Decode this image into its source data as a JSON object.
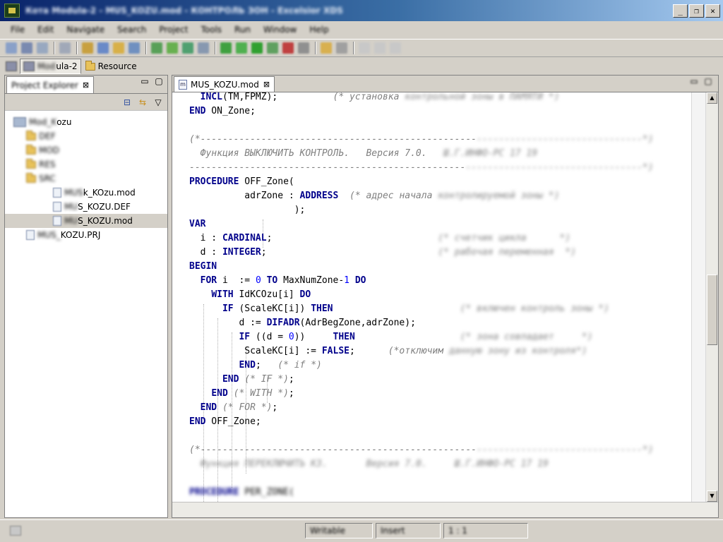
{
  "window": {
    "title": "Кота Modula-2 - MUS_KOZU.mod - КОНТРОЛЬ ЗОН - Excelsior XDS",
    "min_glyph": "_",
    "restore_glyph": "❐",
    "close_glyph": "✕"
  },
  "menu": [
    "File",
    "Edit",
    "Navigate",
    "Search",
    "Project",
    "Tools",
    "Run",
    "Window",
    "Help"
  ],
  "perspectives": {
    "modula_prefix": "Mod",
    "modula_suffix": "ula-2",
    "resource_label": "Resource"
  },
  "explorer": {
    "tab_title": "Project Explorer",
    "close_glyph": "⊠",
    "minimize_glyph": "▭",
    "maximize_glyph": "▢",
    "collapse_glyph": "⊟",
    "link_glyph": "⇆",
    "menu_glyph": "▽",
    "tree": [
      {
        "level": 0,
        "type": "project",
        "blurred": "Mod_K",
        "label": "ozu"
      },
      {
        "level": 1,
        "type": "folder",
        "blurred": "DEF",
        "label": ""
      },
      {
        "level": 1,
        "type": "folder",
        "blurred": "MOD",
        "label": ""
      },
      {
        "level": 1,
        "type": "folder",
        "blurred": "RES",
        "label": ""
      },
      {
        "level": 1,
        "type": "folder",
        "blurred": "SRC",
        "label": ""
      },
      {
        "level": 2,
        "type": "file",
        "blurred": "MUS",
        "label": "k_KOzu.mod"
      },
      {
        "level": 2,
        "type": "file",
        "blurred": "MU",
        "label": "S_KOZU.DEF"
      },
      {
        "level": 2,
        "type": "file",
        "blurred": "MU",
        "label": "S_KOZU.mod",
        "selected": true
      },
      {
        "level": 1,
        "type": "file",
        "blurred": "MUS_",
        "label": "KOZU.PRJ"
      }
    ]
  },
  "editor": {
    "tab_icon_letter": "m",
    "tab_title": "MUS_KOZU.mod",
    "tab_close_glyph": "⊠"
  },
  "code_lines": [
    [
      {
        "t": "  "
      },
      {
        "t": "INCL",
        "c": "kw"
      },
      {
        "t": "(TM,FPMZ);          "
      },
      {
        "t": "(* установка ",
        "c": "cm"
      },
      {
        "t": "контрольной зоны в ПАМЯТИ *)",
        "c": "cm blur"
      }
    ],
    [
      {
        "t": "END",
        "c": "kw"
      },
      {
        "t": " ON_Zone;"
      }
    ],
    [
      {
        "t": ""
      }
    ],
    [
      {
        "t": "(*--------------------------------------------------",
        "c": "cm"
      },
      {
        "t": "------------------------------*)",
        "c": "cm blur"
      }
    ],
    [
      {
        "t": "  Функция ВЫКЛЮЧИТЬ КОНТРОЛЬ.   Версия 7.0.   ",
        "c": "cm"
      },
      {
        "t": "Ш.Г.ИНФО-РС 17 19",
        "c": "cm blur"
      }
    ],
    [
      {
        "t": "--------------------------------------------------",
        "c": "cm"
      },
      {
        "t": "--------------------------------*)",
        "c": "cm blur"
      }
    ],
    [
      {
        "t": "PROCEDURE",
        "c": "kw"
      },
      {
        "t": " OFF_Zone("
      }
    ],
    [
      {
        "t": "          adrZone : "
      },
      {
        "t": "ADDRESS",
        "c": "kw"
      },
      {
        "t": "  "
      },
      {
        "t": "(* адрес начала ",
        "c": "cm"
      },
      {
        "t": "контролируемой зоны *)",
        "c": "cm blur"
      }
    ],
    [
      {
        "t": "                   );"
      }
    ],
    [
      {
        "t": "VAR",
        "c": "kw"
      }
    ],
    [
      {
        "t": "  i : "
      },
      {
        "t": "CARDINAL",
        "c": "kw"
      },
      {
        "t": ";                              "
      },
      {
        "t": "(* счетчик цикла      *)",
        "c": "cm blur"
      }
    ],
    [
      {
        "t": "  d : "
      },
      {
        "t": "INTEGER",
        "c": "kw"
      },
      {
        "t": ";                               "
      },
      {
        "t": "(* рабочая переменная  *)",
        "c": "cm blur"
      }
    ],
    [
      {
        "t": "BEGIN",
        "c": "kw"
      }
    ],
    [
      {
        "t": "  "
      },
      {
        "t": "FOR",
        "c": "kw"
      },
      {
        "t": " i  := "
      },
      {
        "t": "0",
        "c": "num"
      },
      {
        "t": " "
      },
      {
        "t": "TO",
        "c": "kw"
      },
      {
        "t": " MaxNumZone-"
      },
      {
        "t": "1",
        "c": "num"
      },
      {
        "t": " "
      },
      {
        "t": "DO",
        "c": "kw"
      }
    ],
    [
      {
        "t": "    "
      },
      {
        "t": "WITH",
        "c": "kw"
      },
      {
        "t": " IdKCOzu[i] "
      },
      {
        "t": "DO",
        "c": "kw"
      }
    ],
    [
      {
        "t": "      "
      },
      {
        "t": "IF",
        "c": "kw"
      },
      {
        "t": " (ScaleKC[i]) "
      },
      {
        "t": "THEN",
        "c": "kw"
      },
      {
        "t": "                       "
      },
      {
        "t": "(* включен контроль зоны *)",
        "c": "cm blur"
      }
    ],
    [
      {
        "t": "         d := "
      },
      {
        "t": "DIFADR",
        "c": "kw"
      },
      {
        "t": "(AdrBegZone,adrZone);"
      }
    ],
    [
      {
        "t": "         "
      },
      {
        "t": "IF",
        "c": "kw"
      },
      {
        "t": " ((d = "
      },
      {
        "t": "0",
        "c": "num"
      },
      {
        "t": "))     "
      },
      {
        "t": "THEN",
        "c": "kw"
      },
      {
        "t": "                   "
      },
      {
        "t": "(* зона совпадает     *)",
        "c": "cm blur"
      }
    ],
    [
      {
        "t": "          ScaleKC[i] := "
      },
      {
        "t": "FALSE",
        "c": "kw"
      },
      {
        "t": ";      "
      },
      {
        "t": "(*отключим",
        "c": "cm"
      },
      {
        "t": " данную зону из контроля*)",
        "c": "cm blur"
      }
    ],
    [
      {
        "t": "         "
      },
      {
        "t": "END",
        "c": "kw"
      },
      {
        "t": ";   "
      },
      {
        "t": "(* if *)",
        "c": "cm"
      }
    ],
    [
      {
        "t": "      "
      },
      {
        "t": "END",
        "c": "kw"
      },
      {
        "t": " "
      },
      {
        "t": "(* IF *)",
        "c": "cm"
      },
      {
        "t": ";"
      }
    ],
    [
      {
        "t": "    "
      },
      {
        "t": "END",
        "c": "kw"
      },
      {
        "t": " "
      },
      {
        "t": "(* WITH *)",
        "c": "cm"
      },
      {
        "t": ";"
      }
    ],
    [
      {
        "t": "  "
      },
      {
        "t": "END",
        "c": "kw"
      },
      {
        "t": " "
      },
      {
        "t": "(* FOR *)",
        "c": "cm"
      },
      {
        "t": ";"
      }
    ],
    [
      {
        "t": "END",
        "c": "kw"
      },
      {
        "t": " OFF_Zone;"
      }
    ],
    [
      {
        "t": ""
      }
    ],
    [
      {
        "t": "(*--------------------------------------------------",
        "c": "cm"
      },
      {
        "t": "------------------------------*)",
        "c": "cm blur"
      }
    ],
    [
      {
        "t": "  Функция ПЕРЕКЛЮЧИТЬ КЗ.       Версия 7.0.     Ш.Г.ИНФО-РС 17 19",
        "c": "cm blur"
      }
    ],
    [
      {
        "t": ""
      }
    ],
    [
      {
        "t": "PROCEDURE",
        "c": "kw blur"
      },
      {
        "t": " PER_ZONE(",
        "c": "blur"
      }
    ]
  ],
  "status": {
    "field1": "Writable",
    "field2": "Insert",
    "field3": "1 : 1"
  },
  "colors": {
    "keyword": "#00008b",
    "number": "#0000ff",
    "comment": "#808080",
    "chrome": "#d4d0c8"
  }
}
